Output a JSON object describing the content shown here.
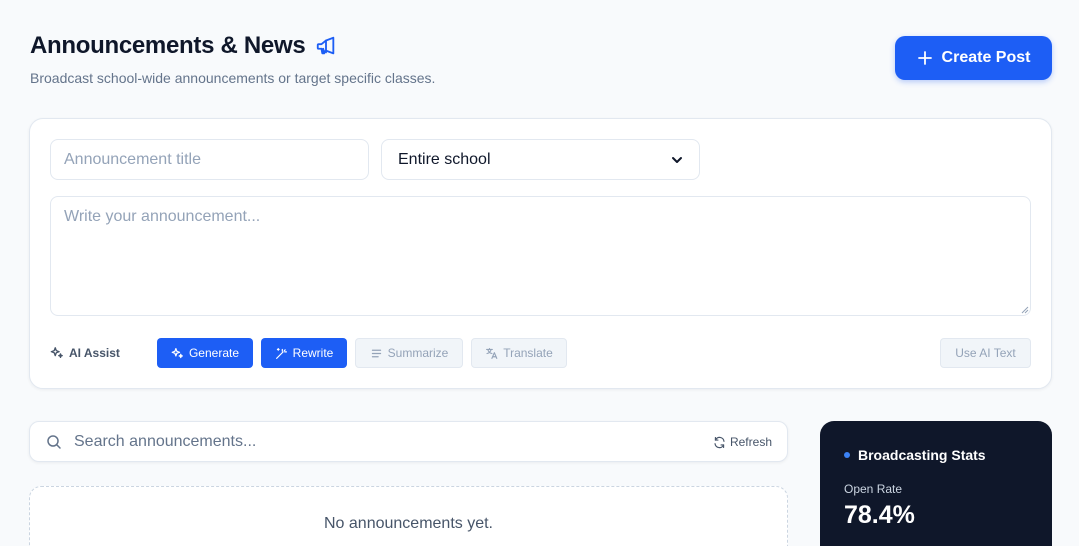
{
  "header": {
    "title": "Announcements & News",
    "subtitle": "Broadcast school-wide announcements or target specific classes.",
    "title_icon": "megaphone-icon"
  },
  "actions": {
    "create_post_label": "Create Post"
  },
  "composer": {
    "title_placeholder": "Announcement title",
    "audience_selected": "Entire school",
    "body_placeholder": "Write your announcement..."
  },
  "ai_tools": {
    "label": "AI Assist",
    "generate_label": "Generate",
    "rewrite_label": "Rewrite",
    "summarize_label": "Summarize",
    "translate_label": "Translate",
    "use_ai_text_label": "Use AI Text"
  },
  "search": {
    "placeholder": "Search announcements...",
    "refresh_label": "Refresh"
  },
  "list": {
    "empty_message": "No announcements yet."
  },
  "stats": {
    "title": "Broadcasting Stats",
    "open_rate_label": "Open Rate",
    "open_rate_value": "78.4%"
  },
  "colors": {
    "accent": "#1d5ef5",
    "dark_card": "#0f172a",
    "background": "#f8fafc"
  }
}
